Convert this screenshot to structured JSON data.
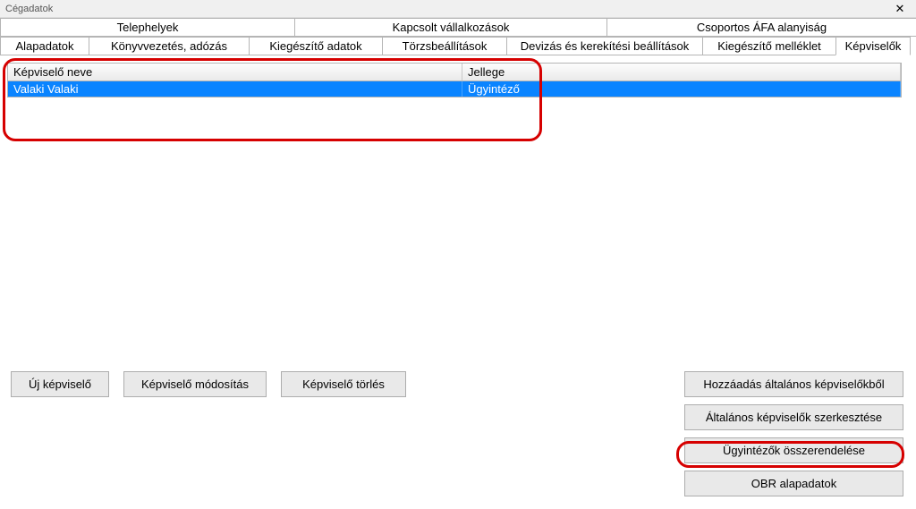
{
  "window": {
    "title": "Cégadatok"
  },
  "tabs_row1": {
    "telephelyek": "Telephelyek",
    "kapcsolt": "Kapcsolt vállalkozások",
    "csoportos": "Csoportos ÁFA alanyiság"
  },
  "tabs_row2": {
    "alapadatok": "Alapadatok",
    "konyvvezetes": "Könyvvezetés, adózás",
    "kiegeszito_adatok": "Kiegészítő adatok",
    "torzsbeallitasok": "Törzsbeállítások",
    "devizas": "Devizás és kerekítési beállítások",
    "kiegeszito_melleklet": "Kiegészítő melléklet",
    "kepviselok": "Képviselők"
  },
  "grid": {
    "headers": {
      "name": "Képviselő neve",
      "type": "Jellege"
    },
    "rows": [
      {
        "name": "Valaki Valaki",
        "type": "Ügyintéző"
      }
    ]
  },
  "buttons": {
    "uj": "Új képviselő",
    "modositas": "Képviselő módosítás",
    "torles": "Képviselő törlés",
    "hozzaadas": "Hozzáadás általános képviselőkből",
    "szerkesztes": "Általános képviselők szerkesztése",
    "osszerendeles": "Ügyintézők összerendelése",
    "obr": "OBR alapadatok"
  }
}
